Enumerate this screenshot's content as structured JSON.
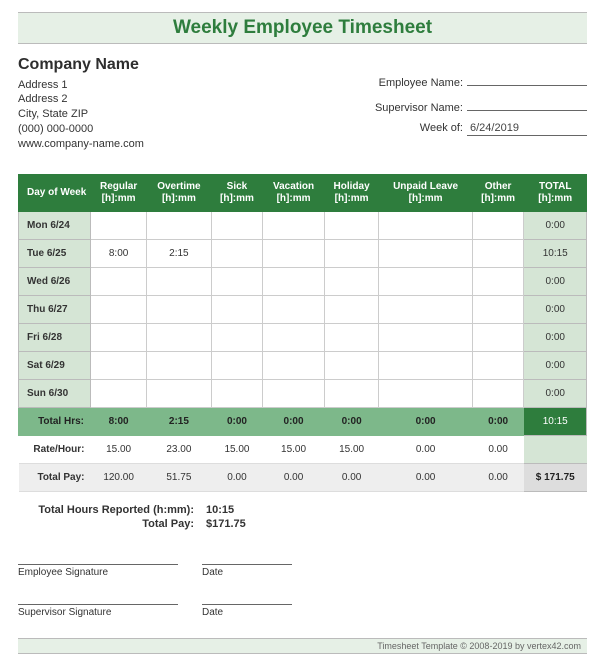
{
  "title": "Weekly Employee Timesheet",
  "company": {
    "name": "Company Name",
    "address1": "Address 1",
    "address2": "Address 2",
    "citystate": "City, State  ZIP",
    "phone": "(000) 000-0000",
    "website": "www.company-name.com"
  },
  "meta": {
    "employee_label": "Employee Name:",
    "employee_value": "",
    "supervisor_label": "Supervisor Name:",
    "supervisor_value": "",
    "weekof_label": "Week of:",
    "weekof_value": "6/24/2019"
  },
  "columns": {
    "day": "Day of Week",
    "regular": "Regular",
    "overtime": "Overtime",
    "sick": "Sick",
    "vacation": "Vacation",
    "holiday": "Holiday",
    "unpaid": "Unpaid Leave",
    "other": "Other",
    "total": "TOTAL",
    "unit": "[h]:mm"
  },
  "rows": [
    {
      "day": "Mon 6/24",
      "regular": "",
      "overtime": "",
      "sick": "",
      "vacation": "",
      "holiday": "",
      "unpaid": "",
      "other": "",
      "total": "0:00"
    },
    {
      "day": "Tue 6/25",
      "regular": "8:00",
      "overtime": "2:15",
      "sick": "",
      "vacation": "",
      "holiday": "",
      "unpaid": "",
      "other": "",
      "total": "10:15"
    },
    {
      "day": "Wed 6/26",
      "regular": "",
      "overtime": "",
      "sick": "",
      "vacation": "",
      "holiday": "",
      "unpaid": "",
      "other": "",
      "total": "0:00"
    },
    {
      "day": "Thu 6/27",
      "regular": "",
      "overtime": "",
      "sick": "",
      "vacation": "",
      "holiday": "",
      "unpaid": "",
      "other": "",
      "total": "0:00"
    },
    {
      "day": "Fri 6/28",
      "regular": "",
      "overtime": "",
      "sick": "",
      "vacation": "",
      "holiday": "",
      "unpaid": "",
      "other": "",
      "total": "0:00"
    },
    {
      "day": "Sat 6/29",
      "regular": "",
      "overtime": "",
      "sick": "",
      "vacation": "",
      "holiday": "",
      "unpaid": "",
      "other": "",
      "total": "0:00"
    },
    {
      "day": "Sun 6/30",
      "regular": "",
      "overtime": "",
      "sick": "",
      "vacation": "",
      "holiday": "",
      "unpaid": "",
      "other": "",
      "total": "0:00"
    }
  ],
  "totalhrs": {
    "label": "Total Hrs:",
    "regular": "8:00",
    "overtime": "2:15",
    "sick": "0:00",
    "vacation": "0:00",
    "holiday": "0:00",
    "unpaid": "0:00",
    "other": "0:00",
    "total": "10:15"
  },
  "rate": {
    "label": "Rate/Hour:",
    "regular": "15.00",
    "overtime": "23.00",
    "sick": "15.00",
    "vacation": "15.00",
    "holiday": "15.00",
    "unpaid": "0.00",
    "other": "0.00",
    "total": ""
  },
  "pay": {
    "label": "Total Pay:",
    "regular": "120.00",
    "overtime": "51.75",
    "sick": "0.00",
    "vacation": "0.00",
    "holiday": "0.00",
    "unpaid": "0.00",
    "other": "0.00",
    "total": "$   171.75"
  },
  "summary": {
    "hours_label": "Total Hours Reported (h:mm):",
    "hours_value": "10:15",
    "pay_label": "Total Pay:",
    "pay_value": "$171.75"
  },
  "signatures": {
    "employee": "Employee Signature",
    "supervisor": "Supervisor Signature",
    "date": "Date"
  },
  "footer": "Timesheet Template © 2008-2019 by vertex42.com"
}
